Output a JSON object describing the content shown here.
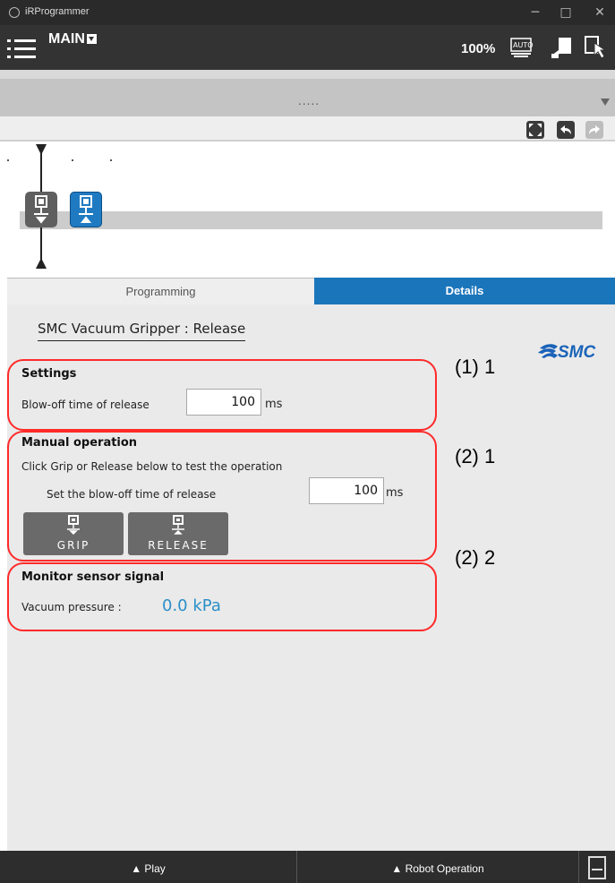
{
  "window": {
    "title": "iRProgrammer",
    "controls": [
      "─",
      "□",
      "✕"
    ]
  },
  "header": {
    "program_name": "MAIN",
    "speed": "100%",
    "icons": [
      "menu-icon",
      "auto-mode-icon",
      "teach-pendant-icon",
      "touch-icon"
    ]
  },
  "band": {
    "dots": "....."
  },
  "toolbar": {
    "icons": [
      "fit-view-icon",
      "undo-icon",
      "redo-icon"
    ]
  },
  "timeline": {
    "blocks": [
      {
        "name": "gripper-grip-block",
        "color": "#5f5f5f"
      },
      {
        "name": "gripper-release-block",
        "color": "#1f7ac2"
      }
    ]
  },
  "tabs": {
    "programming": "Programming",
    "details": "Details"
  },
  "details": {
    "title": "SMC Vacuum Gripper : Release",
    "logo": "SMC",
    "settings": {
      "title": "Settings",
      "blowoff_label": "Blow-off time of release",
      "blowoff_value": "100",
      "unit": "ms"
    },
    "manual": {
      "title": "Manual operation",
      "instruction": "Click Grip or Release below to test the operation",
      "blowoff_label": "Set the blow-off time of release",
      "blowoff_value": "100",
      "unit": "ms",
      "grip_label": "GRIP",
      "release_label": "RELEASE"
    },
    "monitor": {
      "title": "Monitor sensor signal",
      "vacuum_label": "Vacuum pressure :",
      "vacuum_value": "0.0 kPa"
    }
  },
  "annotations": {
    "a1": "(1)  1",
    "a2": "(2)  1",
    "a3": "(2) 2",
    "color": "#ff2a2a"
  },
  "bottom": {
    "play": "▲ Play",
    "robot_operation": "▲ Robot Operation"
  },
  "colors": {
    "accent": "#1b75bb",
    "value": "#2b8fc8"
  }
}
